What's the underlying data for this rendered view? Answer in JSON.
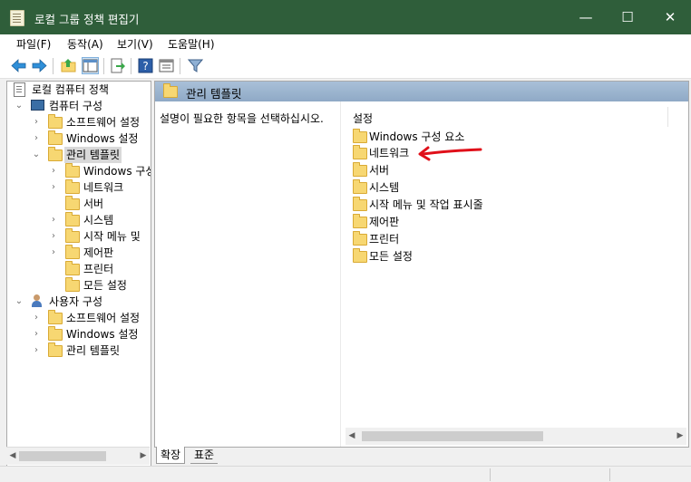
{
  "window": {
    "title": "로컬 그룹 정책 편집기"
  },
  "controls": {
    "minimize": "—",
    "maximize": "☐",
    "close": "✕"
  },
  "menu": [
    "파일(F)",
    "동작(A)",
    "보기(V)",
    "도움말(H)"
  ],
  "tree": {
    "root": "로컬 컴퓨터 정책",
    "computer": "컴퓨터 구성",
    "computer_children": [
      "소프트웨어 설정",
      "Windows 설정",
      "관리 템플릿"
    ],
    "admin_children": [
      "Windows 구성",
      "네트워크",
      "서버",
      "시스템",
      "시작 메뉴 및",
      "제어판",
      "프린터",
      "모든 설정"
    ],
    "user": "사용자 구성",
    "user_children": [
      "소프트웨어 설정",
      "Windows 설정",
      "관리 템플릿"
    ]
  },
  "right": {
    "header": "관리 템플릿",
    "description": "설명이 필요한 항목을 선택하십시오.",
    "column": "설정",
    "items": [
      "Windows 구성 요소",
      "네트워크",
      "서버",
      "시스템",
      "시작 메뉴 및 작업 표시줄",
      "제어판",
      "프린터",
      "모든 설정"
    ]
  },
  "tabs": [
    "확장",
    "표준"
  ],
  "colors": {
    "titlebar": "#2f5e3a",
    "header": "#99b4d1",
    "annotation": "#e0101a"
  }
}
